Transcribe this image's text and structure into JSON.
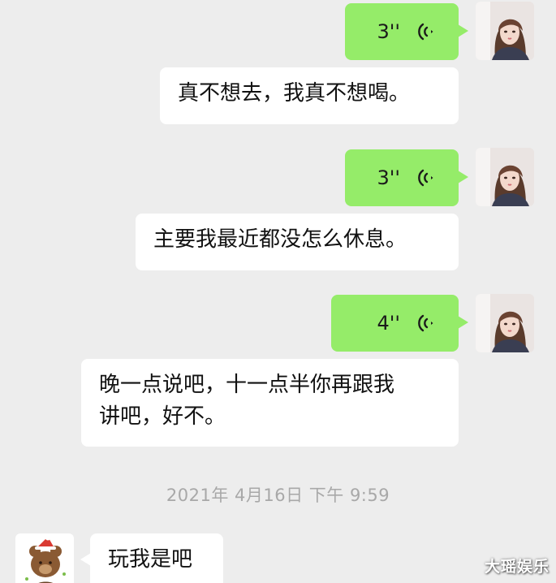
{
  "messages": [
    {
      "type": "voice",
      "duration": "3''"
    },
    {
      "type": "text",
      "content": "真不想去，我真不想喝。"
    },
    {
      "type": "voice",
      "duration": "3''"
    },
    {
      "type": "text",
      "content": "主要我最近都没怎么休息。"
    },
    {
      "type": "voice",
      "duration": "4''"
    },
    {
      "type": "text",
      "lines": [
        "晚一点说吧，十一点半你再跟我",
        "讲吧，好不。"
      ]
    }
  ],
  "timestamp": "2021年 4月16日 下午 9:59",
  "incoming": {
    "content": "玩我是吧"
  },
  "watermark": "大瑶娱乐",
  "colors": {
    "background": "#ededed",
    "voice_bubble": "#95ec69",
    "text_bubble": "#ffffff",
    "timestamp": "#a8a8a8"
  },
  "icons": {
    "voice": "voice-wave-icon",
    "avatar_self": "girl-avatar",
    "avatar_other": "bear-avatar"
  }
}
